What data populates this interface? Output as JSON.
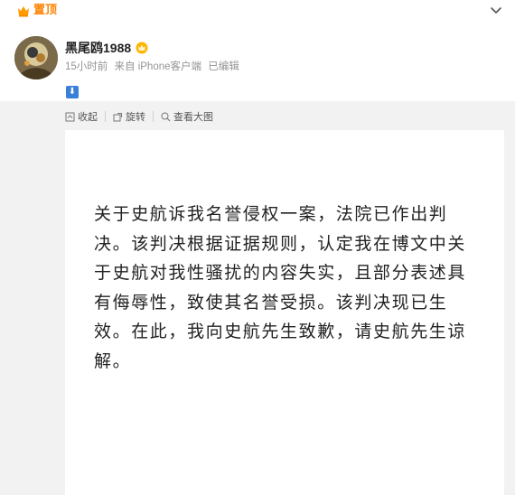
{
  "header": {
    "pin_label": "置顶",
    "pin_icon": "crown-icon",
    "collapse_icon": "chevron-down-icon"
  },
  "user": {
    "name": "黑尾鸥1988",
    "badge_icon": "vip-crown-icon",
    "time": "15小时前",
    "source": "来自 iPhone客户端",
    "edited": "已编辑"
  },
  "post": {
    "arrow_glyph": "⬇",
    "statement": "关于史航诉我名誉侵权一案，法院已作出判决。该判决根据证据规则，认定我在博文中关于史航对我性骚扰的内容失实，且部分表述具有侮辱性，致使其名誉受损。该判决现已生效。在此，我向史航先生致歉，请史航先生谅解。"
  },
  "toolbar": {
    "collapse_label": "收起",
    "rotate_label": "旋转",
    "view_large_label": "查看大图"
  },
  "watermark": "        "
}
